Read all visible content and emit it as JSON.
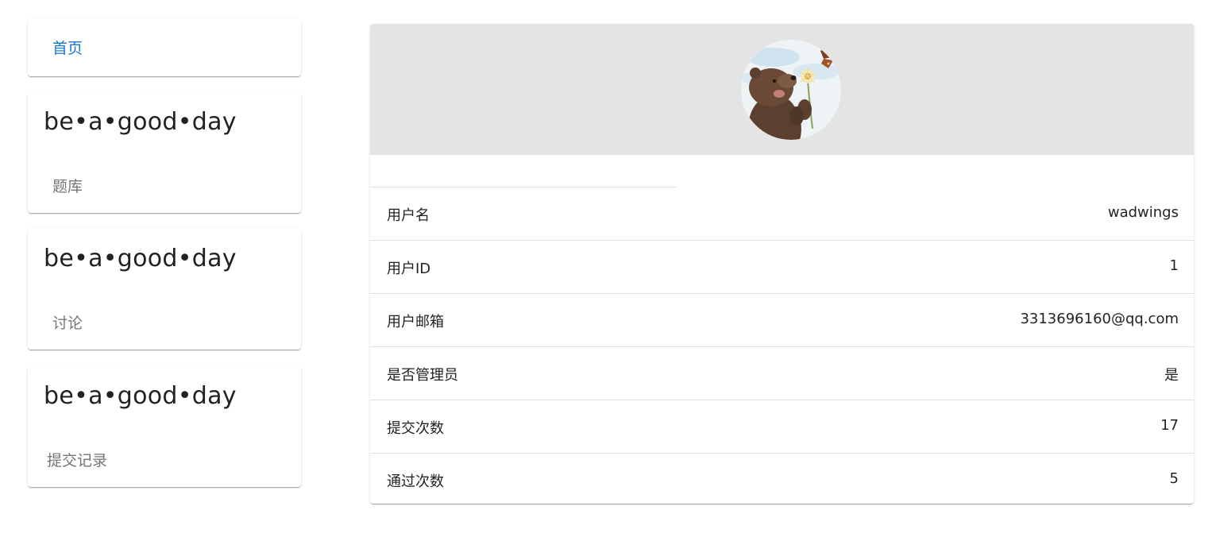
{
  "nav": {
    "home_label": "首页",
    "cards": [
      {
        "title": "be•a•good•day",
        "link": "题库"
      },
      {
        "title": "be•a•good•day",
        "link": "讨论"
      },
      {
        "title": "be•a•good•day",
        "link": "提交记录"
      }
    ]
  },
  "profile": {
    "avatar": "avatar-image-bear-with-dandelion-and-butterfly",
    "rows": [
      {
        "key": "用户名",
        "value": "wadwings"
      },
      {
        "key": "用户ID",
        "value": "1"
      },
      {
        "key": "用户邮箱",
        "value": "3313696160@qq.com"
      },
      {
        "key": "是否管理员",
        "value": "是"
      },
      {
        "key": "提交次数",
        "value": "17"
      },
      {
        "key": "通过次数",
        "value": "5"
      }
    ]
  },
  "colors": {
    "link_blue": "#1976d2",
    "header_gray": "#e4e4e4"
  }
}
